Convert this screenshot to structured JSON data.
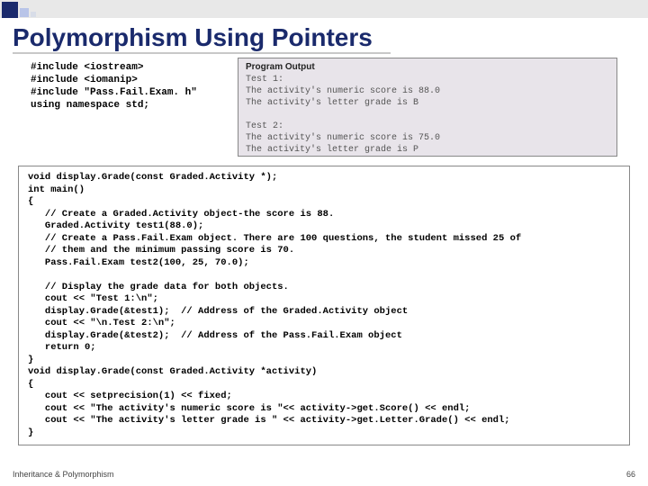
{
  "header": {
    "title": "Polymorphism Using Pointers"
  },
  "includes": "#include <iostream>\n#include <iomanip>\n#include \"Pass.Fail.Exam. h\"\nusing namespace std;",
  "output": {
    "header": "Program Output",
    "body": "Test 1:\nThe activity's numeric score is 88.0\nThe activity's letter grade is B\n\nTest 2:\nThe activity's numeric score is 75.0\nThe activity's letter grade is P"
  },
  "code": "void display.Grade(const Graded.Activity *);\nint main()\n{\n   // Create a Graded.Activity object-the score is 88.\n   Graded.Activity test1(88.0);\n   // Create a Pass.Fail.Exam object. There are 100 questions, the student missed 25 of\n   // them and the minimum passing score is 70.\n   Pass.Fail.Exam test2(100, 25, 70.0);\n\n   // Display the grade data for both objects.\n   cout << \"Test 1:\\n\";\n   display.Grade(&test1);  // Address of the Graded.Activity object\n   cout << \"\\n.Test 2:\\n\";\n   display.Grade(&test2);  // Address of the Pass.Fail.Exam object\n   return 0;\n}\nvoid display.Grade(const Graded.Activity *activity)\n{\n   cout << setprecision(1) << fixed;\n   cout << \"The activity's numeric score is \"<< activity->get.Score() << endl;\n   cout << \"The activity's letter grade is \" << activity->get.Letter.Grade() << endl;\n}",
  "footer": {
    "left": "Inheritance & Polymorphism",
    "page": "66"
  }
}
